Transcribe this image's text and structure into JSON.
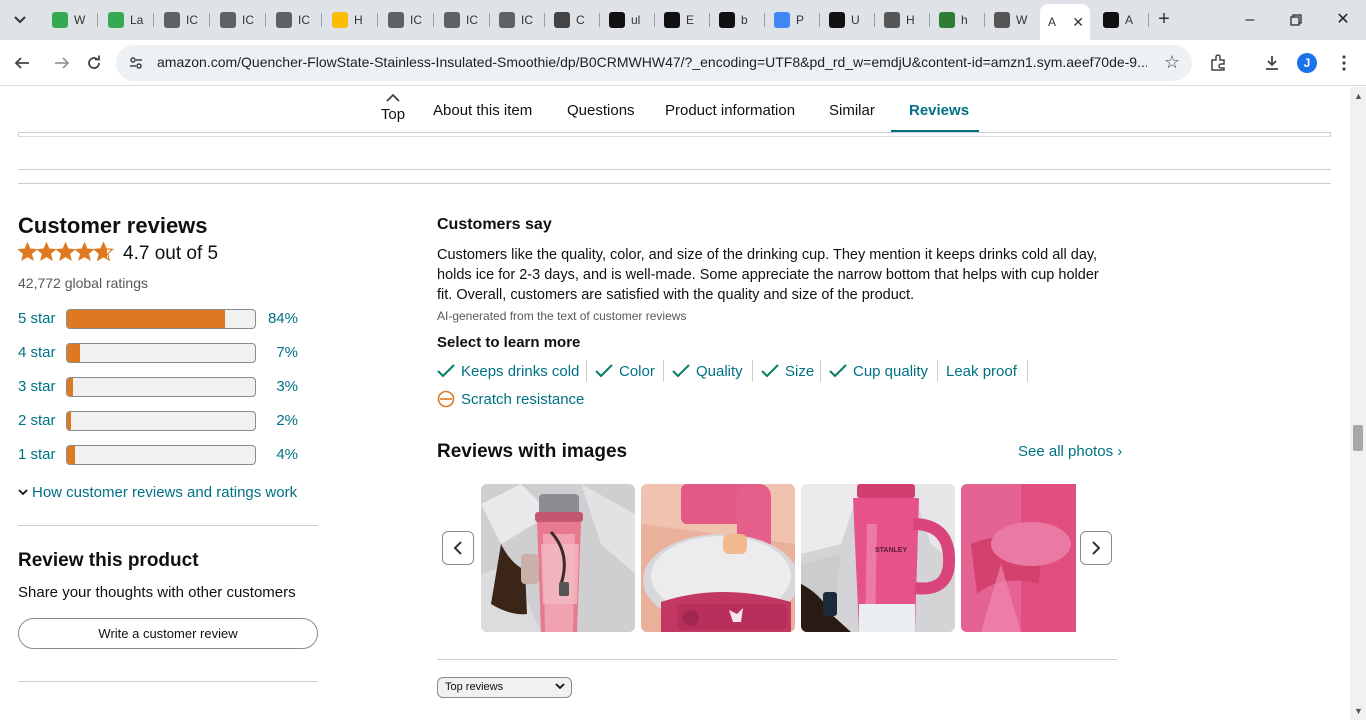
{
  "browser": {
    "tabs": [
      {
        "title": "W",
        "fav_color": "#34a853",
        "fav_glyph": ""
      },
      {
        "title": "La",
        "fav_color": "#34a853",
        "fav_glyph": ""
      },
      {
        "title": "IC",
        "fav_color": "#5f6368",
        "fav_glyph": ""
      },
      {
        "title": "IC",
        "fav_color": "#5f6368",
        "fav_glyph": ""
      },
      {
        "title": "IC",
        "fav_color": "#5f6368",
        "fav_glyph": ""
      },
      {
        "title": "H",
        "fav_color": "#fbbc04",
        "fav_glyph": ""
      },
      {
        "title": "IC",
        "fav_color": "#5f6368",
        "fav_glyph": ""
      },
      {
        "title": "IC",
        "fav_color": "#5f6368",
        "fav_glyph": ""
      },
      {
        "title": "IC",
        "fav_color": "#5f6368",
        "fav_glyph": ""
      },
      {
        "title": "C",
        "fav_color": "#444",
        "fav_glyph": ""
      },
      {
        "title": "ul",
        "fav_color": "#111",
        "fav_glyph": ""
      },
      {
        "title": "E",
        "fav_color": "#111",
        "fav_glyph": ""
      },
      {
        "title": "b",
        "fav_color": "#111",
        "fav_glyph": ""
      },
      {
        "title": "P",
        "fav_color": "#4285f4",
        "fav_glyph": ""
      },
      {
        "title": "U",
        "fav_color": "#111",
        "fav_glyph": ""
      },
      {
        "title": "H",
        "fav_color": "#555",
        "fav_glyph": ""
      },
      {
        "title": "h",
        "fav_color": "#2e7d32",
        "fav_glyph": ""
      },
      {
        "title": "W",
        "fav_color": "#555",
        "fav_glyph": ""
      },
      {
        "title": "A",
        "fav_color": "#fff",
        "fav_glyph": ""
      },
      {
        "title": "A",
        "fav_color": "#111",
        "fav_glyph": ""
      }
    ],
    "url": "amazon.com/Quencher-FlowState-Stainless-Insulated-Smoothie/dp/B0CRMWHW47/?_encoding=UTF8&pd_rd_w=emdjU&content-id=amzn1.sym.aeef70de-9...",
    "avatar_letter": "J"
  },
  "subnav": {
    "top_label": "Top",
    "items": [
      "About this item",
      "Questions",
      "Product information",
      "Similar",
      "Reviews"
    ],
    "active": "Reviews"
  },
  "reviews": {
    "title": "Customer reviews",
    "rating": 4.7,
    "rating_text": "4.7 out of 5",
    "global_ratings": "42,772 global ratings",
    "star_color": "#de7921",
    "histogram": [
      {
        "label": "5 star",
        "percent": 84,
        "pct_text": "84%"
      },
      {
        "label": "4 star",
        "percent": 7,
        "pct_text": "7%"
      },
      {
        "label": "3 star",
        "percent": 3,
        "pct_text": "3%"
      },
      {
        "label": "2 star",
        "percent": 2,
        "pct_text": "2%"
      },
      {
        "label": "1 star",
        "percent": 4,
        "pct_text": "4%"
      }
    ],
    "how_link": "How customer reviews and ratings work",
    "review_product_title": "Review this product",
    "review_product_sub": "Share your thoughts with other customers",
    "write_button": "Write a customer review"
  },
  "customers_say": {
    "title": "Customers say",
    "body": "Customers like the quality, color, and size of the drinking cup. They mention it keeps drinks cold all day, holds ice for 2-3 days, and is well-made. Some appreciate the narrow bottom that helps with cup holder fit. Overall, customers are satisfied with the quality and size of the product.",
    "ai_note": "AI-generated from the text of customer reviews",
    "select_title": "Select to learn more",
    "aspects": [
      {
        "label": "Keeps drinks cold",
        "icon": "check-icon"
      },
      {
        "label": "Color",
        "icon": "check-icon"
      },
      {
        "label": "Quality",
        "icon": "check-icon"
      },
      {
        "label": "Size",
        "icon": "check-icon"
      },
      {
        "label": "Cup quality",
        "icon": "check-icon"
      },
      {
        "label": "Leak proof",
        "icon": ""
      },
      {
        "label": "Scratch resistance",
        "icon": "minus-circle-icon"
      }
    ]
  },
  "reviews_with_images": {
    "title": "Reviews with images",
    "see_all": "See all photos ›"
  },
  "sort": {
    "selected": "Top reviews"
  }
}
